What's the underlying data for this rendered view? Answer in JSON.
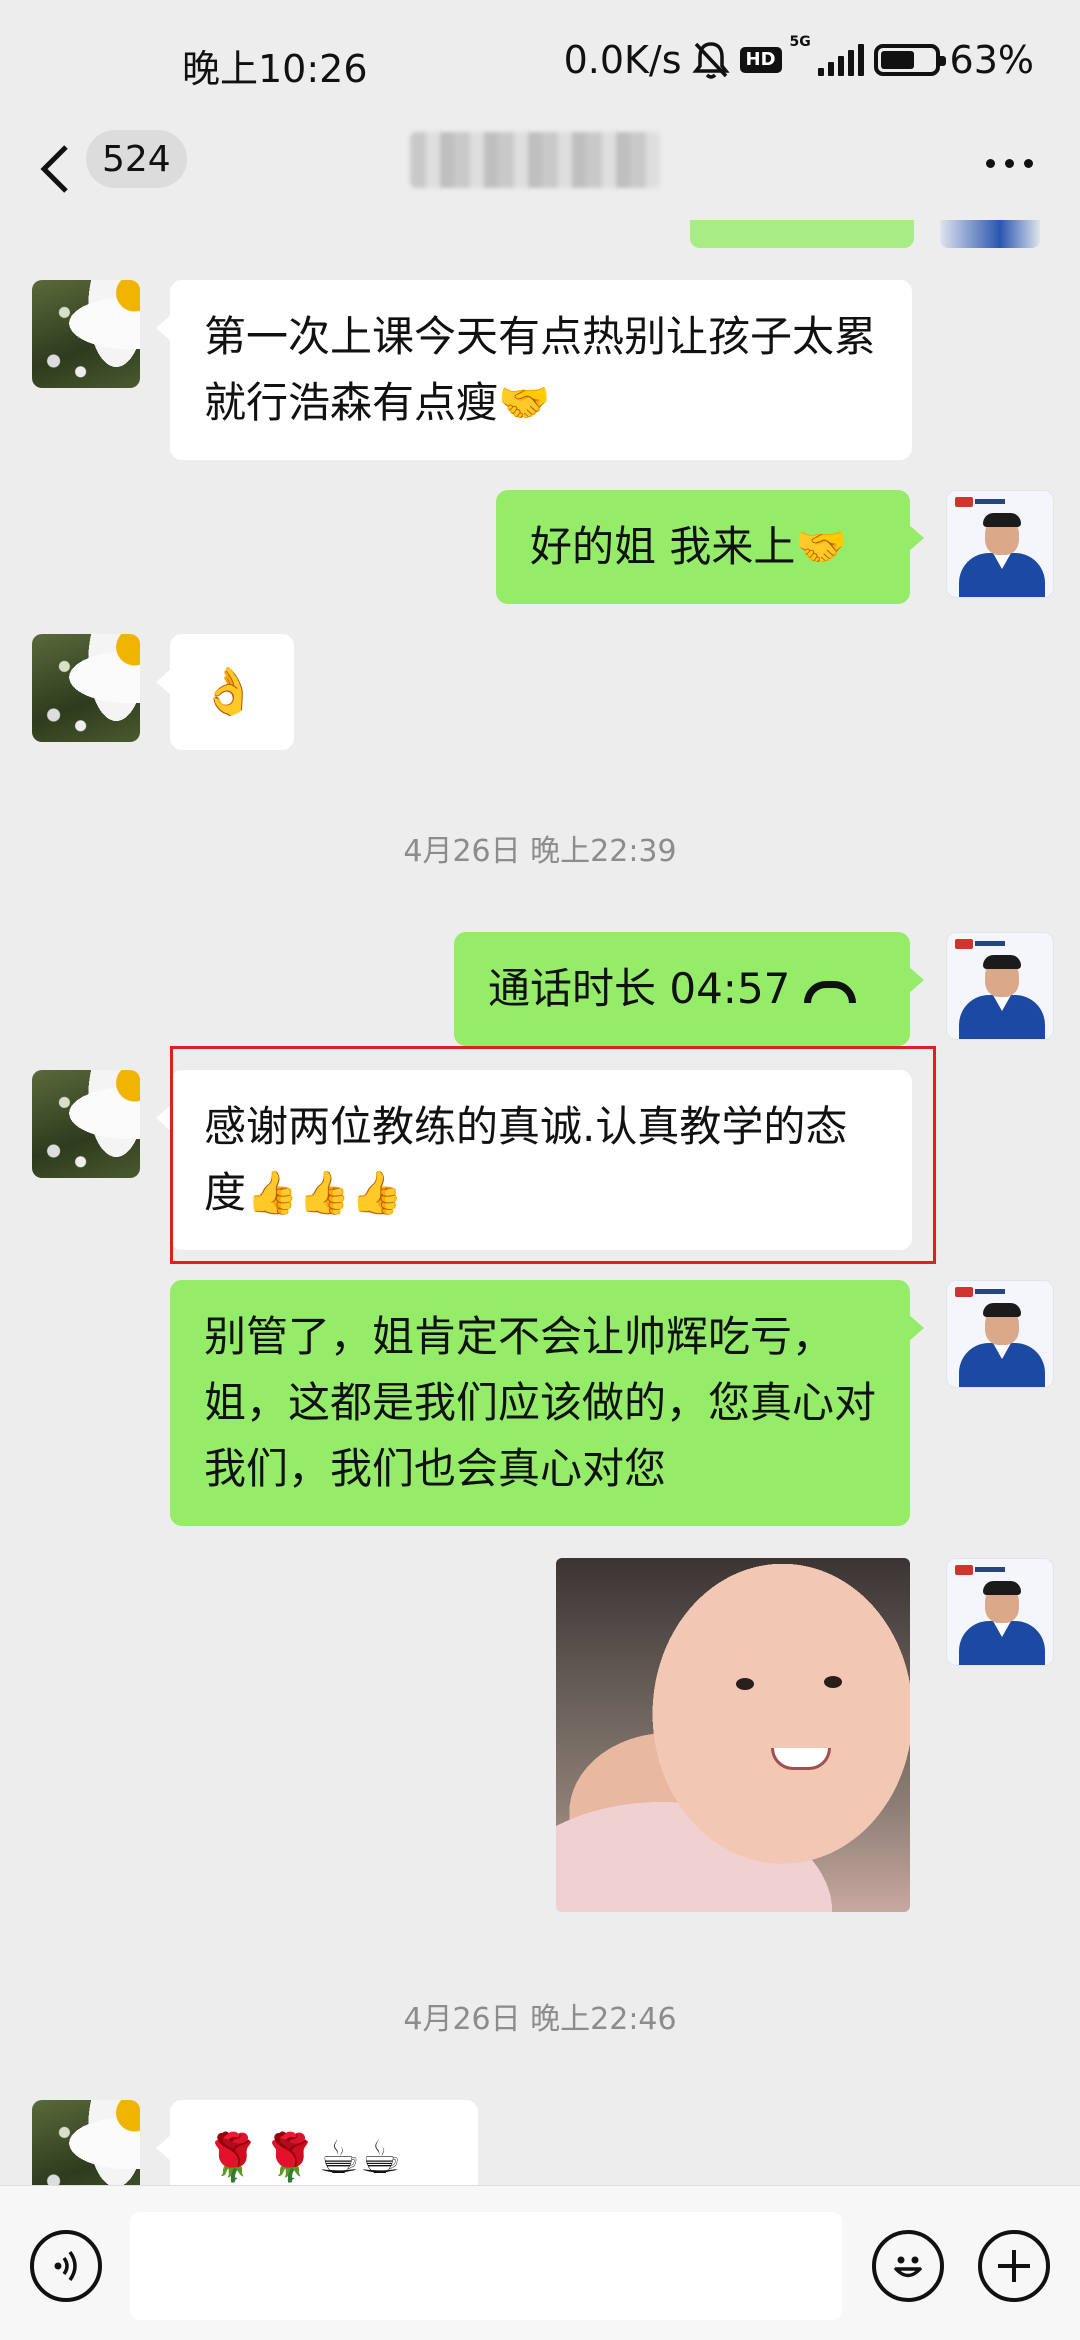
{
  "status_bar": {
    "time": "晚上10:26",
    "network_speed": "0.0K/s",
    "mute_icon": "bell-off-icon",
    "hd_badge": "HD",
    "signal_label": "5G",
    "battery_percent": "63%",
    "battery_level": 0.63
  },
  "nav": {
    "back_icon": "chevron-left-icon",
    "unread_count": "524",
    "more_icon": "more-horizontal-icon"
  },
  "messages": [
    {
      "id": "m1",
      "side": "in",
      "text": "第一次上课今天有点热别让孩子太累就行浩森有点瘦🤝"
    },
    {
      "id": "m2",
      "side": "out",
      "text": "好的姐 我来上🤝"
    },
    {
      "id": "m3",
      "side": "in",
      "text": "👌"
    },
    {
      "id": "t1",
      "type": "timestamp",
      "text": "4月26日 晚上22:39"
    },
    {
      "id": "m4",
      "side": "out",
      "type": "call",
      "text": "通话时长 04:57"
    },
    {
      "id": "m5",
      "side": "in",
      "text": "感谢两位教练的真诚.认真教学的态度👍👍👍",
      "highlighted": true
    },
    {
      "id": "m6",
      "side": "out",
      "text": "别管了，姐肯定不会让帅辉吃亏，姐，这都是我们应该做的，您真心对我们，我们也会真心对您"
    },
    {
      "id": "m7",
      "side": "out",
      "type": "image"
    },
    {
      "id": "t2",
      "type": "timestamp",
      "text": "4月26日 晚上22:46"
    },
    {
      "id": "m8",
      "side": "in",
      "text": "🌹🌹☕☕"
    }
  ],
  "input_bar": {
    "voice_icon": "voice-wave-icon",
    "emoji_icon": "smiley-icon",
    "plus_icon": "plus-icon"
  },
  "colors": {
    "background": "#ededed",
    "outgoing_bubble": "#95ec69",
    "incoming_bubble": "#ffffff",
    "highlight_border": "#e02020",
    "timestamp_text": "#8c8c8c"
  }
}
